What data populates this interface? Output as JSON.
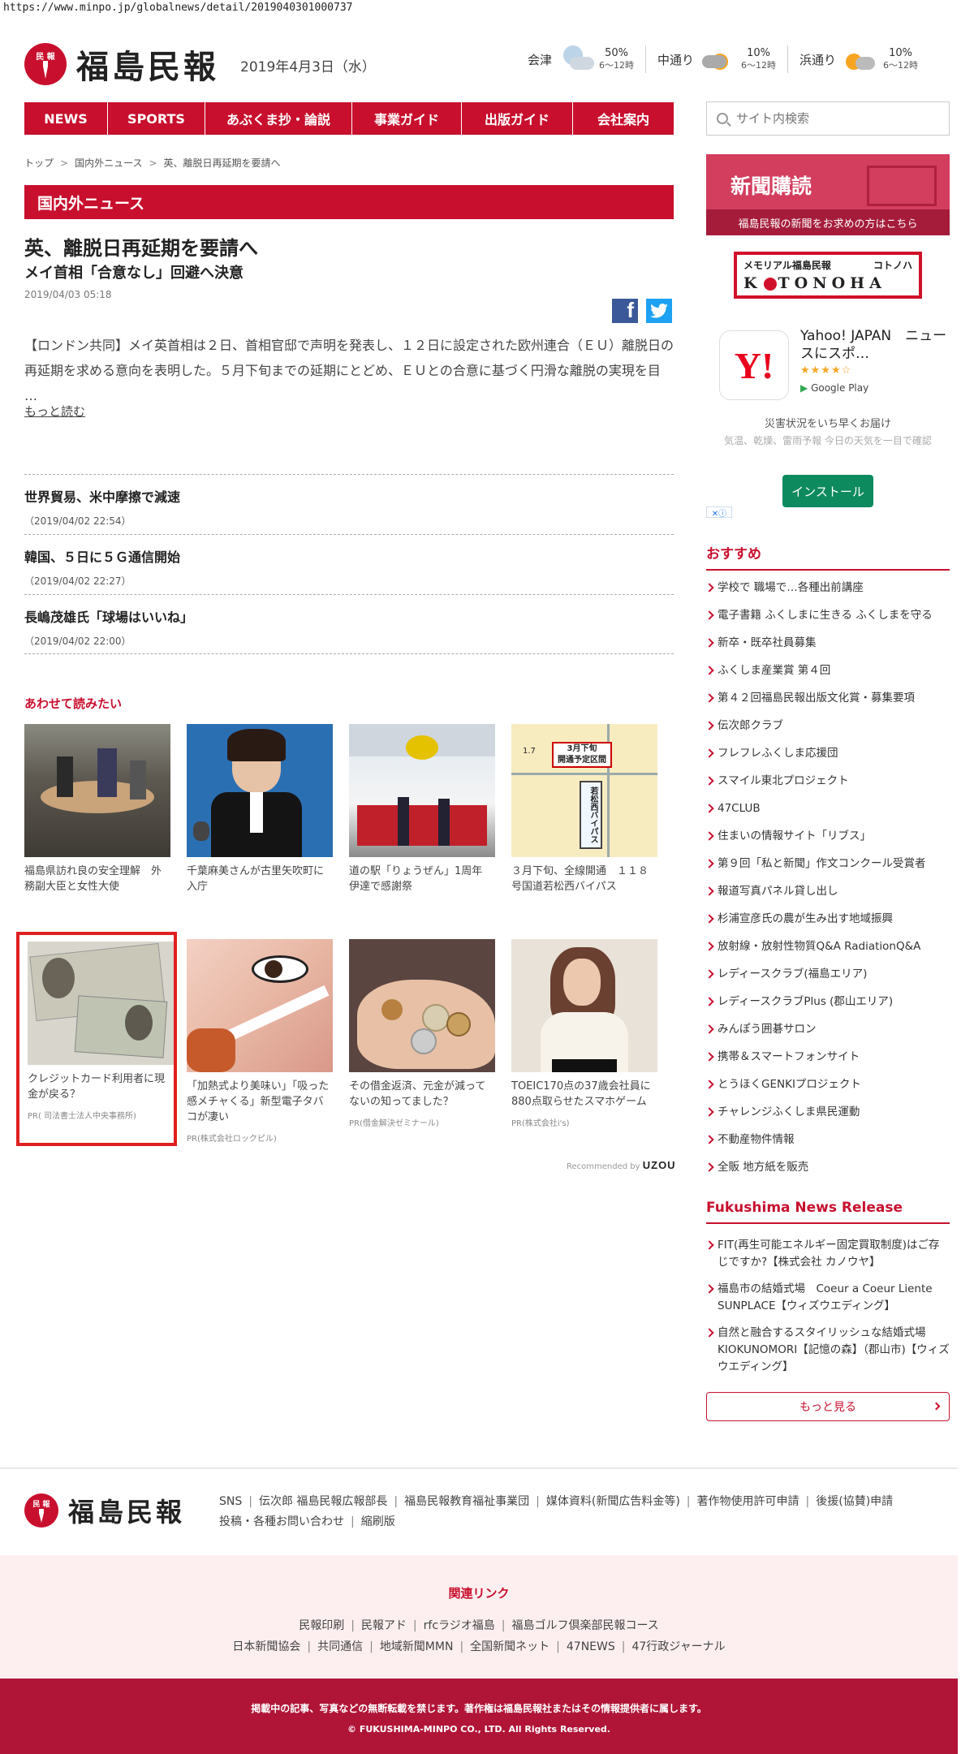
{
  "url": "https://www.minpo.jp/globalnews/detail/2019040301000737",
  "brand": {
    "seal_text": "民 報",
    "name": "福島民報"
  },
  "date": "2019年4月3日（水）",
  "weather": [
    {
      "location": "会津",
      "icon": "cloud-rain-icon",
      "percent": "50%",
      "time": "6～12時"
    },
    {
      "location": "中通り",
      "icon": "cloud-sun-icon",
      "percent": "10%",
      "time": "6～12時"
    },
    {
      "location": "浜通り",
      "icon": "sun-cloud-icon",
      "percent": "10%",
      "time": "6～12時"
    }
  ],
  "nav": [
    "NEWS",
    "SPORTS",
    "あぶくま抄・論説",
    "事業ガイド",
    "出版ガイド",
    "会社案内"
  ],
  "search": {
    "placeholder": "サイト内検索"
  },
  "breadcrumb": [
    "トップ",
    "国内外ニュース",
    "英、離脱日再延期を要請へ"
  ],
  "section_title": "国内外ニュース",
  "article": {
    "headline": "英、離脱日再延期を要請へ",
    "subhead": "メイ首相「合意なし」回避へ決意",
    "datetime": "2019/04/03 05:18",
    "lead": "【ロンドン共同】メイ英首相は２日、首相官邸で声明を発表し、１２日に設定された欧州連合（ＥＵ）離脱日の再延期を求める意向を表明した。５月下旬までの延期にとどめ、ＥＵとの合意に基づく円滑な離脱の実現を目 …",
    "more": "もっと読む"
  },
  "news_list": [
    {
      "title": "世界貿易、米中摩擦で減速",
      "date": "（2019/04/02 22:54）"
    },
    {
      "title": "韓国、５日に５Ｇ通信開始",
      "date": "（2019/04/02 22:27）"
    },
    {
      "title": "長嶋茂雄氏「球場はいいね」",
      "date": "（2019/04/02 22:00）"
    }
  ],
  "related": {
    "title": "あわせて読みたい",
    "row1": [
      {
        "caption": "福島県訪れ良の安全理解　外務副大臣と女性大使"
      },
      {
        "caption": "千葉麻美さんが古里矢吹町に入庁"
      },
      {
        "caption": "道の駅「りょうぜん」1周年　伊達で感謝祭"
      },
      {
        "caption": "３月下旬、全線開通　１１８号国道若松西バイパス"
      }
    ],
    "row2": [
      {
        "caption": "クレジットカード利用者に現金が戻る？",
        "pr": "PR( 司法書士法人中央事務所)"
      },
      {
        "caption": "「加熱式より美味い」「吸った感メチャくる」新型電子タバコが凄い",
        "pr": "PR(株式会社ロックピル)"
      },
      {
        "caption": "その借金返済、元金が減ってないの知ってました？",
        "pr": "PR(借金解決ゼミナール)"
      },
      {
        "caption": "TOEIC170点の37歳会社員に880点取らせたスマホゲーム",
        "pr": "PR(株式会社i's)"
      }
    ],
    "map_text": {
      "a": "3月下旬",
      "b": "開通予定区間",
      "c": "若松西バイパス",
      "d": "1.7"
    },
    "recommended_by": "Recommended by",
    "recommended_brand": "UZOU"
  },
  "sidebar": {
    "subscribe": {
      "title": "新聞購読",
      "sub": "福島民報の新聞をお求めの方はこちら"
    },
    "kotonoha": {
      "top_left": "メモリアル福島民報",
      "top_right": "コトノハ",
      "logo_pre": "K",
      "logo_post": "TONOHA"
    },
    "ad": {
      "app_name": "Yahoo! JAPAN　ニュースにスポ…",
      "stars": "★★★★☆",
      "store": "Google Play",
      "tagline": "災害状況をいち早くお届け",
      "desc": "気温、乾燥、雷雨予報 今日の天気を一目で確認",
      "install": "インストール",
      "adchoice": "✕ⓘ"
    },
    "recommend_title": "おすすめ",
    "recommend": [
      "学校で 職場で…各種出前講座",
      "電子書籍 ふくしまに生きる ふくしまを守る",
      "新卒・既卒社員募集",
      "ふくしま産業賞 第４回",
      "第４２回福島民報出版文化賞・募集要項",
      "伝次郎クラブ",
      "フレフレふくしま応援団",
      "スマイル東北プロジェクト",
      "47CLUB",
      "住まいの情報サイト「リブス」",
      "第９回「私と新聞」作文コンクール受賞者",
      "報道写真パネル貸し出し",
      "杉浦宣彦氏の農が生み出す地域振興",
      "放射線・放射性物質Q&A RadiationQ&A",
      "レディースクラブ(福島エリア)",
      "レディースクラブPlus (郡山エリア)",
      "みんぽう囲碁サロン",
      "携帯＆スマートフォンサイト",
      "とうほくGENKIプロジェクト",
      "チャレンジふくしま県民運動",
      "不動産物件情報",
      "全販 地方紙を販売"
    ],
    "release_title": "Fukushima News Release",
    "releases": [
      "FIT(再生可能エネルギー固定買取制度)はご存じですか?【株式会社 カノウヤ】",
      "福島市の結婚式場　Coeur a Coeur Liente SUNPLACE【ウィズウエディング】",
      "自然と融合するスタイリッシュな結婚式場　　KIOKUNOMORI【記憶の森】（郡山市)【ウィズウエディング】"
    ],
    "more": "もっと見る"
  },
  "footer": {
    "links_row1": [
      "SNS",
      "伝次郎 福島民報広報部長",
      "福島民報教育福祉事業団",
      "媒体資料(新聞広告料金等)",
      "著作物使用許可申請",
      "後援(協賛)申請"
    ],
    "links_row2": [
      "投稿・各種お問い合わせ",
      "縮刷版"
    ],
    "related_title": "関連リンク",
    "related_row1": [
      "民報印刷",
      "民報アド",
      "rfcラジオ福島",
      "福島ゴルフ倶楽部民報コース"
    ],
    "related_row2": [
      "日本新聞協会",
      "共同通信",
      "地域新聞MMN",
      "全国新聞ネット",
      "47NEWS",
      "47行政ジャーナル"
    ],
    "notice": "掲載中の記事、写真などの無断転載を禁じます。著作権は福島民報社またはその情報提供者に属します。",
    "copyright": "© FUKUSHIMA-MINPO CO., LTD. All Rights Reserved."
  },
  "colors": {
    "brand_red": "#c8102e",
    "footer_red": "#b01538",
    "pink_bg": "#fdeff0"
  }
}
